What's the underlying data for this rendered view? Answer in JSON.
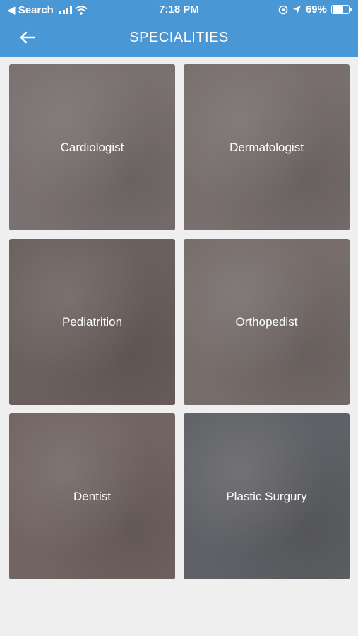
{
  "status_bar": {
    "back_app": "◀ Search",
    "time": "7:18 PM",
    "battery": "69%",
    "battery_level": 0.69
  },
  "header": {
    "title": "SPECIALITIES",
    "back_icon": "arrow-left-icon"
  },
  "specialities": [
    {
      "label": "Cardiologist",
      "color": "#b9b1ad"
    },
    {
      "label": "Dermatologist",
      "color": "#b6aeaa"
    },
    {
      "label": "Pediatrition",
      "color": "#9a8c86"
    },
    {
      "label": "Orthopedist",
      "color": "#b3aaa4"
    },
    {
      "label": "Dentist",
      "color": "#a99690"
    },
    {
      "label": "Plastic Surgury",
      "color": "#7f8f9a"
    }
  ],
  "colors": {
    "accent": "#4a97d6",
    "background": "#efeff0"
  }
}
